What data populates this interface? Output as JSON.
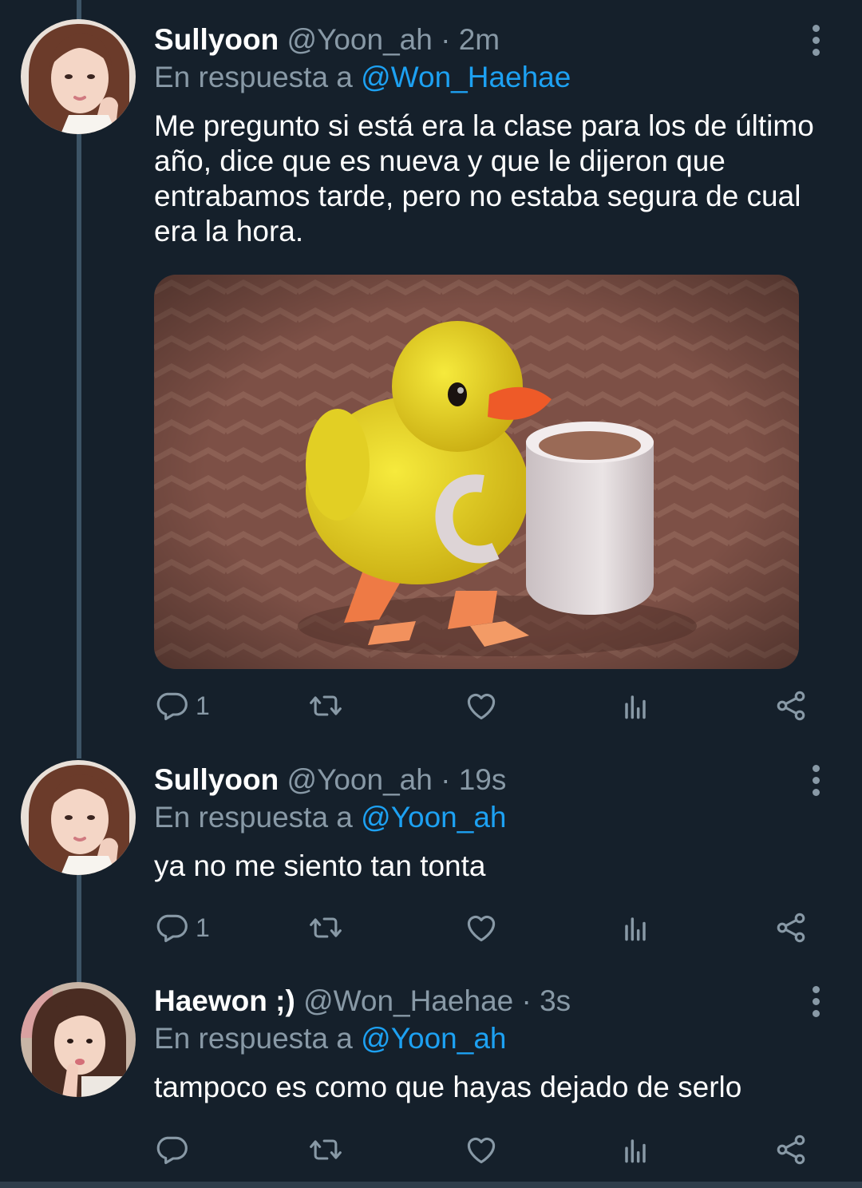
{
  "tweets": [
    {
      "name": "Sullyoon",
      "handle": "@Yoon_ah",
      "separator": "·",
      "time": "2m",
      "reply_prefix": "En respuesta a",
      "reply_to": "@Won_Haehae",
      "text": "Me pregunto si está era la clase para los de último año, dice que es nueva y que le dijeron que entrabamos tarde, pero no estaba segura de cual era la hora.",
      "reply_count": "1",
      "has_media": true
    },
    {
      "name": "Sullyoon",
      "handle": "@Yoon_ah",
      "separator": "·",
      "time": "19s",
      "reply_prefix": "En respuesta a",
      "reply_to": "@Yoon_ah",
      "text": "ya no me siento tan tonta",
      "reply_count": "1"
    },
    {
      "name": "Haewon ;)",
      "handle": "@Won_Haehae",
      "separator": "·",
      "time": "3s",
      "reply_prefix": "En respuesta a",
      "reply_to": "@Yoon_ah",
      "text": "tampoco es como que hayas dejado de serlo",
      "reply_count": ""
    }
  ],
  "icons": {
    "reply": "reply-icon",
    "retweet": "retweet-icon",
    "like": "heart-icon",
    "analytics": "analytics-icon",
    "share": "share-icon",
    "more": "more-vertical-icon"
  },
  "colors": {
    "background": "#15202b",
    "text": "#ffffff",
    "secondary": "#8899a6",
    "accent": "#1da1f2",
    "thread_line": "#3d5466"
  }
}
